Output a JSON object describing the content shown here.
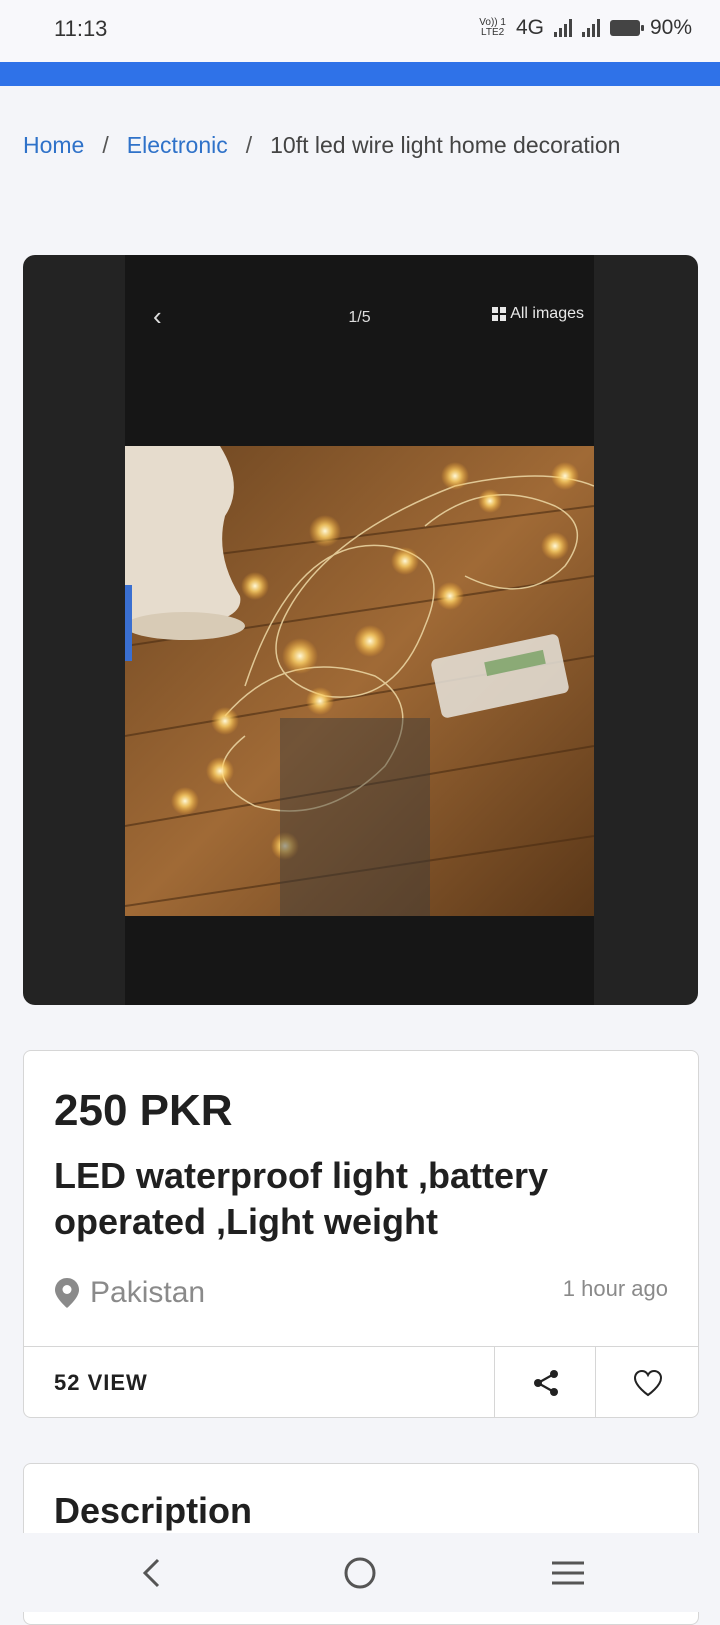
{
  "status": {
    "time": "11:13",
    "volte": "Vo)) 1",
    "lte": "LTE2",
    "network": "4G",
    "battery": "90%"
  },
  "breadcrumb": {
    "home": "Home",
    "sep": "/",
    "category": "Electronic",
    "current": "10ft led wire light home decoration"
  },
  "gallery": {
    "counter": "1/5",
    "all_images": "All images"
  },
  "listing": {
    "price": "250 PKR",
    "title": "LED waterproof light ,battery operated ,Light weight",
    "location": "Pakistan",
    "posted": "1 hour ago",
    "views": "52 VIEW"
  },
  "description": {
    "heading": "Description"
  },
  "colors": {
    "accent": "#2f72e8",
    "link": "#2f72c9"
  }
}
